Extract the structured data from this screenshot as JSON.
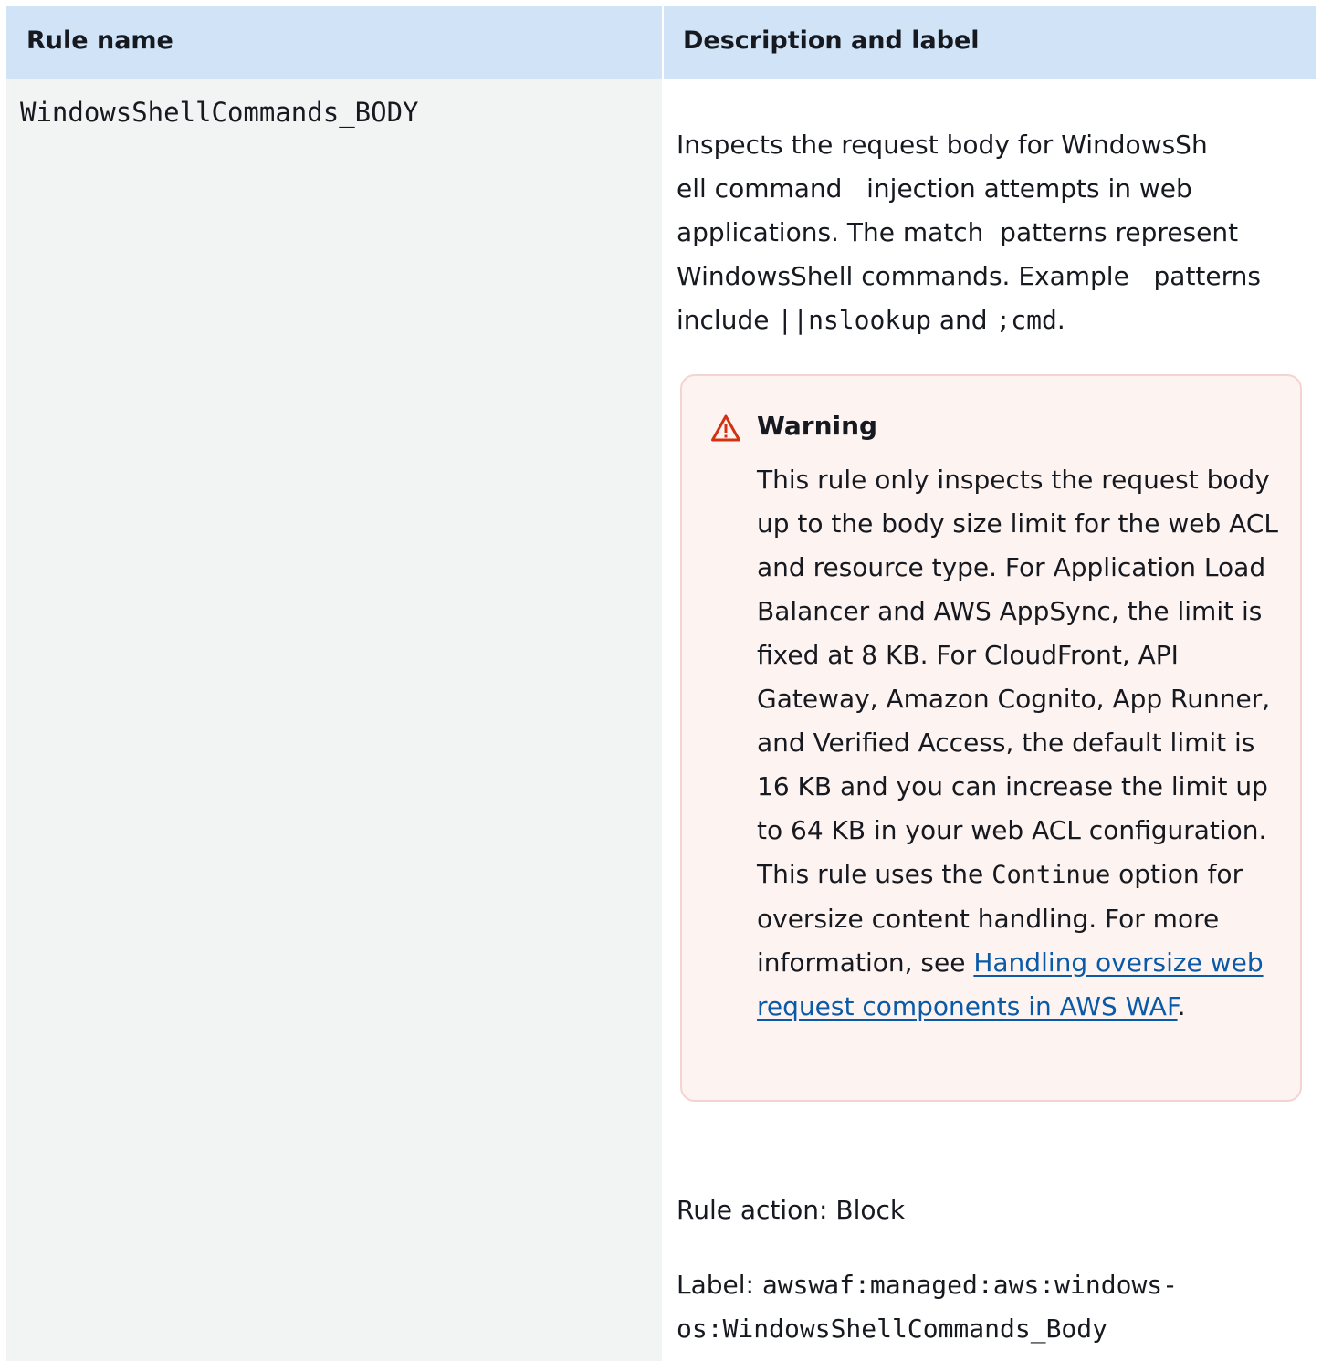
{
  "table": {
    "headers": [
      "Rule name",
      "Description and label"
    ],
    "row": {
      "rule_name": "WindowsShellCommands_BODY",
      "description": {
        "line1": "Inspects the request body for WindowsSh",
        "line2": "ell command   injection attempts in web",
        "line3": "applications. The match  patterns represent",
        "line4": "WindowsShell commands. Example   patterns",
        "line5_prefix": "include ",
        "code1": "||nslookup",
        "and_text": " and ",
        "code2": ";cmd",
        "end": "."
      },
      "warning": {
        "icon": "warning-triangle-icon",
        "title": "Warning",
        "text_before_code": "This rule only inspects the request body up to the body size limit for the web ACL and resource type. For Application Load Balancer and AWS AppSync, the limit is fixed at 8 KB. For CloudFront, API Gateway, Amazon Cognito, App Runner, and Verified Access, the default limit is 16 KB and you can increase the limit up to 64 KB in your web ACL configuration. This rule uses the ",
        "code": "Continue",
        "text_after_code": " option for oversize content handling. For more information, see ",
        "link_text": "Handling oversize web request components in AWS WAF",
        "end": "."
      },
      "rule_action": "Rule action: Block",
      "label_prefix": "Label: ",
      "label_value": " awswaf:managed:aws:windows-os:WindowsShellCommands_Body"
    }
  },
  "colors": {
    "header_bg": "#d1e4f7",
    "left_column_bg": "#f2f3f3",
    "warning_bg": "#fdf3f1",
    "warning_border": "#f4d4d0",
    "warning_icon": "#d13212",
    "link": "#0a5aa8"
  }
}
